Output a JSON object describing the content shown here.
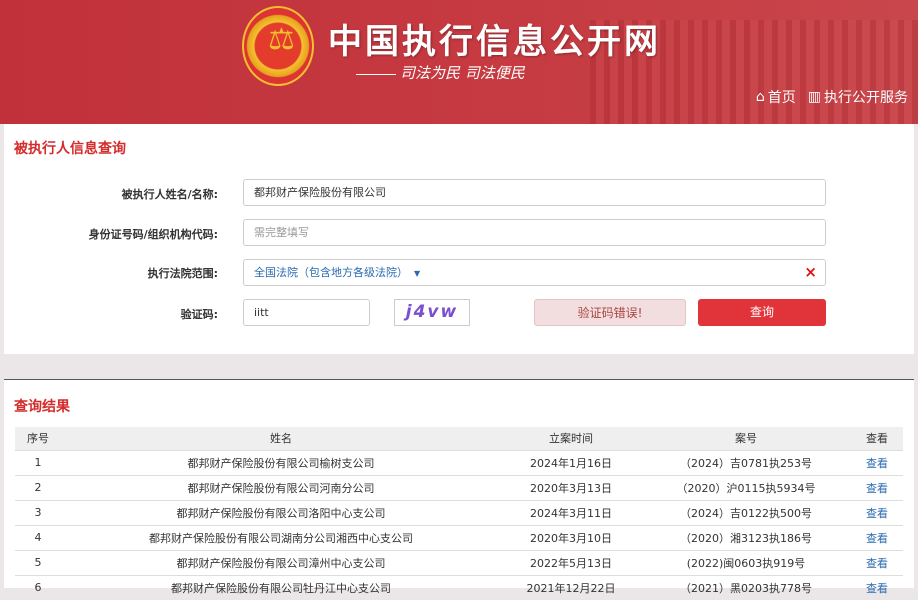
{
  "header": {
    "title": "中国执行信息公开网",
    "slogan": "司法为民  司法便民",
    "nav": [
      {
        "label": "首页",
        "icon": "home-icon"
      },
      {
        "label": "执行公开服务",
        "icon": "chart-icon"
      }
    ]
  },
  "search": {
    "title": "被执行人信息查询",
    "name_label": "被执行人姓名/名称:",
    "name_value": "都邦财产保险股份有限公司",
    "id_label": "身份证号码/组织机构代码:",
    "id_placeholder": "需完整填写",
    "court_label": "执行法院范围:",
    "court_value": "全国法院（包含地方各级法院）",
    "clear": "×",
    "captcha_label": "验证码:",
    "captcha_value": "iitt",
    "captcha_image": "j4vw",
    "captcha_error": "验证码错误!",
    "submit": "查询"
  },
  "results": {
    "title": "查询结果",
    "columns": [
      "序号",
      "姓名",
      "立案时间",
      "案号",
      "查看"
    ],
    "rows": [
      {
        "no": "1",
        "name": "都邦财产保险股份有限公司榆树支公司",
        "date": "2024年1月16日",
        "case": "（2024）吉0781执253号",
        "view": "查看"
      },
      {
        "no": "2",
        "name": "都邦财产保险股份有限公司河南分公司",
        "date": "2020年3月13日",
        "case": "（2020）沪0115执5934号",
        "view": "查看"
      },
      {
        "no": "3",
        "name": "都邦财产保险股份有限公司洛阳中心支公司",
        "date": "2024年3月11日",
        "case": "（2024）吉0122执500号",
        "view": "查看"
      },
      {
        "no": "4",
        "name": "都邦财产保险股份有限公司湖南分公司湘西中心支公司",
        "date": "2020年3月10日",
        "case": "（2020）湘3123执186号",
        "view": "查看"
      },
      {
        "no": "5",
        "name": "都邦财产保险股份有限公司漳州中心支公司",
        "date": "2022年5月13日",
        "case": "(2022)闽0603执919号",
        "view": "查看"
      },
      {
        "no": "6",
        "name": "都邦财产保险股份有限公司牡丹江中心支公司",
        "date": "2021年12月22日",
        "case": "（2021）黑0203执778号",
        "view": "查看"
      }
    ]
  }
}
